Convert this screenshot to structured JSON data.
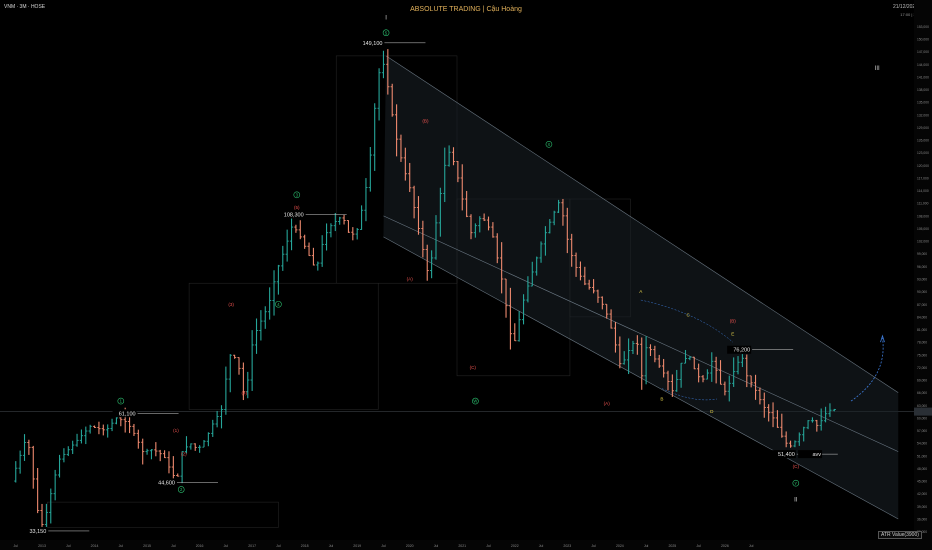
{
  "header": {
    "symbol": "VNM · 3M · HOSE",
    "brand": "ABSOLUTE TRADING | Cậu Hoàng",
    "date": "21/12/2025",
    "meta": "17:00 | 30"
  },
  "footer": {
    "atr_label": "ATR Value(3900)"
  },
  "colors": {
    "up": "#26a69a",
    "down": "#ef8a6f",
    "channel": "#8a9aa8",
    "background": "#000000",
    "label_green": "#2bbd6e",
    "label_red": "#ef5350",
    "label_yellow": "#e8d44d"
  },
  "chart_data": {
    "type": "candlestick",
    "price_axis": {
      "min": 31000,
      "max": 155000,
      "ticks": [
        33000,
        36000,
        39000,
        42000,
        45000,
        48000,
        51000,
        54000,
        57000,
        60000,
        63000,
        66000,
        69000,
        72000,
        75000,
        78000,
        81000,
        84000,
        87000,
        90000,
        93000,
        96000,
        99000,
        102000,
        105000,
        108000,
        111000,
        114000,
        117000,
        120000,
        123000,
        126000,
        129000,
        132000,
        135000,
        138000,
        141000,
        144000,
        147000,
        150000,
        153000
      ]
    },
    "time_axis": {
      "start": "2012-01",
      "end": "2026-12",
      "labels": [
        {
          "t": 2012.0,
          "text": "Jul"
        },
        {
          "t": 2012.5,
          "text": "2013"
        },
        {
          "t": 2013.0,
          "text": "Jul"
        },
        {
          "t": 2013.5,
          "text": "2014"
        },
        {
          "t": 2014.0,
          "text": "Jul"
        },
        {
          "t": 2014.5,
          "text": "2015"
        },
        {
          "t": 2015.0,
          "text": "Jul"
        },
        {
          "t": 2015.5,
          "text": "2016"
        },
        {
          "t": 2016.0,
          "text": "Jul"
        },
        {
          "t": 2016.5,
          "text": "2017"
        },
        {
          "t": 2017.0,
          "text": "Jul"
        },
        {
          "t": 2017.5,
          "text": "2018"
        },
        {
          "t": 2018.0,
          "text": "Jul"
        },
        {
          "t": 2018.5,
          "text": "2019"
        },
        {
          "t": 2019.0,
          "text": "Jul"
        },
        {
          "t": 2019.5,
          "text": "2020"
        },
        {
          "t": 2020.0,
          "text": "Jul"
        },
        {
          "t": 2020.5,
          "text": "2021"
        },
        {
          "t": 2021.0,
          "text": "Jul"
        },
        {
          "t": 2021.5,
          "text": "2022"
        },
        {
          "t": 2022.0,
          "text": "Jul"
        },
        {
          "t": 2022.5,
          "text": "2023"
        },
        {
          "t": 2023.0,
          "text": "Jul"
        },
        {
          "t": 2023.5,
          "text": "2024"
        },
        {
          "t": 2024.0,
          "text": "Jul"
        },
        {
          "t": 2024.5,
          "text": "2025"
        },
        {
          "t": 2025.0,
          "text": "Jul"
        },
        {
          "t": 2025.5,
          "text": "2026"
        },
        {
          "t": 2026.0,
          "text": "Jul"
        }
      ]
    },
    "path": [
      [
        2012.0,
        45000
      ],
      [
        2012.3,
        56000
      ],
      [
        2012.5,
        38000
      ],
      [
        2012.6,
        34000
      ],
      [
        2012.9,
        50000
      ],
      [
        2013.2,
        54000
      ],
      [
        2013.5,
        58000
      ],
      [
        2013.8,
        57000
      ],
      [
        2014.0,
        60000
      ],
      [
        2014.2,
        59000
      ],
      [
        2014.35,
        56000
      ],
      [
        2014.5,
        52000
      ],
      [
        2014.7,
        52500
      ],
      [
        2014.9,
        51000
      ],
      [
        2015.05,
        47000
      ],
      [
        2015.15,
        45000
      ],
      [
        2015.25,
        52000
      ],
      [
        2015.4,
        54000
      ],
      [
        2015.55,
        52500
      ],
      [
        2015.7,
        55000
      ],
      [
        2015.85,
        59000
      ],
      [
        2016.0,
        62000
      ],
      [
        2016.15,
        75000
      ],
      [
        2016.3,
        74000
      ],
      [
        2016.45,
        64000
      ],
      [
        2016.6,
        79000
      ],
      [
        2016.75,
        83000
      ],
      [
        2016.9,
        87000
      ],
      [
        2017.05,
        95000
      ],
      [
        2017.2,
        100000
      ],
      [
        2017.35,
        106000
      ],
      [
        2017.5,
        103000
      ],
      [
        2017.65,
        99000
      ],
      [
        2017.8,
        95000
      ],
      [
        2017.95,
        103000
      ],
      [
        2018.1,
        106000
      ],
      [
        2018.3,
        108000
      ],
      [
        2018.45,
        103000
      ],
      [
        2018.6,
        105000
      ],
      [
        2018.8,
        118000
      ],
      [
        2018.95,
        138000
      ],
      [
        2019.05,
        146000
      ],
      [
        2019.15,
        140000
      ],
      [
        2019.3,
        128000
      ],
      [
        2019.45,
        120000
      ],
      [
        2019.6,
        114000
      ],
      [
        2019.8,
        102000
      ],
      [
        2019.95,
        93000
      ],
      [
        2020.1,
        108000
      ],
      [
        2020.3,
        124000
      ],
      [
        2020.45,
        120000
      ],
      [
        2020.6,
        111000
      ],
      [
        2020.75,
        104000
      ],
      [
        2020.95,
        108000
      ],
      [
        2021.15,
        104000
      ],
      [
        2021.35,
        92000
      ],
      [
        2021.5,
        80000
      ],
      [
        2021.6,
        78000
      ],
      [
        2021.7,
        86000
      ],
      [
        2021.9,
        94000
      ],
      [
        2022.1,
        102000
      ],
      [
        2022.3,
        108000
      ],
      [
        2022.45,
        112000
      ],
      [
        2022.55,
        104000
      ],
      [
        2022.7,
        97000
      ],
      [
        2022.9,
        92000
      ],
      [
        2023.1,
        90000
      ],
      [
        2023.3,
        86000
      ],
      [
        2023.45,
        80000
      ],
      [
        2023.6,
        72000
      ],
      [
        2023.75,
        76000
      ],
      [
        2023.9,
        79000
      ],
      [
        2024.0,
        70000
      ],
      [
        2024.1,
        78000
      ],
      [
        2024.25,
        74000
      ],
      [
        2024.45,
        70000
      ],
      [
        2024.6,
        66000
      ],
      [
        2024.75,
        73000
      ],
      [
        2024.9,
        75000
      ],
      [
        2025.05,
        70000
      ],
      [
        2025.2,
        69000
      ],
      [
        2025.35,
        74000
      ],
      [
        2025.5,
        68000
      ],
      [
        2025.6,
        66000
      ],
      [
        2025.75,
        71000
      ],
      [
        2025.9,
        75000
      ],
      [
        2026.0,
        70000
      ],
      [
        2026.15,
        67000
      ],
      [
        2026.3,
        63000
      ],
      [
        2026.5,
        60000
      ],
      [
        2026.65,
        56000
      ],
      [
        2026.8,
        53000
      ],
      [
        2026.9,
        54000
      ],
      [
        2027.05,
        57000
      ],
      [
        2027.2,
        60000
      ],
      [
        2027.35,
        58000
      ],
      [
        2027.5,
        61000
      ],
      [
        2027.6,
        62000
      ]
    ],
    "price_labels": [
      {
        "text": "149,100",
        "t": 2019.0,
        "price": 149100
      },
      {
        "text": "108,300",
        "t": 2017.5,
        "price": 108300
      },
      {
        "text": "61,100",
        "t": 2014.3,
        "price": 61100
      },
      {
        "text": "44,600",
        "t": 2015.05,
        "price": 44600
      },
      {
        "text": "33,150",
        "t": 2012.6,
        "price": 33150
      },
      {
        "text": "76,200",
        "t": 2026.0,
        "price": 76200
      },
      {
        "text": "51,400",
        "t": 2026.85,
        "price": 51400
      },
      {
        "text": "avv",
        "t": 2027.35,
        "price": 51400
      }
    ],
    "wave_labels": [
      {
        "text": "I",
        "t": 2019.05,
        "price": 155000,
        "style": "plain"
      },
      {
        "text": "5",
        "t": 2019.05,
        "price": 151500,
        "style": "green-circle"
      },
      {
        "text": "3",
        "t": 2017.35,
        "price": 113000,
        "style": "green-circle"
      },
      {
        "text": "(5)",
        "t": 2017.35,
        "price": 110000,
        "style": "red"
      },
      {
        "text": "4",
        "t": 2017.0,
        "price": 87000,
        "style": "green-circle"
      },
      {
        "text": "(3)",
        "t": 2016.1,
        "price": 87000,
        "style": "red"
      },
      {
        "text": "(4)",
        "t": 2016.35,
        "price": 66000,
        "style": "red"
      },
      {
        "text": "1",
        "t": 2014.0,
        "price": 64000,
        "style": "green-circle"
      },
      {
        "text": "(1)",
        "t": 2015.05,
        "price": 57000,
        "style": "red"
      },
      {
        "text": "(2)",
        "t": 2015.2,
        "price": 51500,
        "style": "red"
      },
      {
        "text": "2",
        "t": 2015.15,
        "price": 43000,
        "style": "green-circle"
      },
      {
        "text": "(B)",
        "t": 2019.8,
        "price": 130500,
        "style": "red"
      },
      {
        "text": "(A)",
        "t": 2019.5,
        "price": 93000,
        "style": "red"
      },
      {
        "text": "(C)",
        "t": 2020.7,
        "price": 72000,
        "style": "red"
      },
      {
        "text": "W",
        "t": 2020.75,
        "price": 64000,
        "style": "green-circle"
      },
      {
        "text": "X",
        "t": 2022.15,
        "price": 125000,
        "style": "green-circle"
      },
      {
        "text": "(A)",
        "t": 2023.25,
        "price": 63500,
        "style": "red"
      },
      {
        "text": "A",
        "t": 2023.9,
        "price": 90000,
        "style": "yellow"
      },
      {
        "text": "B",
        "t": 2024.3,
        "price": 64500,
        "style": "yellow"
      },
      {
        "text": "C",
        "t": 2024.8,
        "price": 84500,
        "style": "yellow"
      },
      {
        "text": "D",
        "t": 2025.25,
        "price": 61500,
        "style": "yellow"
      },
      {
        "text": "E",
        "t": 2025.65,
        "price": 80000,
        "style": "yellow"
      },
      {
        "text": "(B)",
        "t": 2025.65,
        "price": 83000,
        "style": "red"
      },
      {
        "text": "(C)",
        "t": 2026.85,
        "price": 48500,
        "style": "red"
      },
      {
        "text": "Y",
        "t": 2026.85,
        "price": 44500,
        "style": "green-circle"
      },
      {
        "text": "II",
        "t": 2026.85,
        "price": 40500,
        "style": "plain"
      },
      {
        "text": "III",
        "t": 2028.4,
        "price": 143000,
        "style": "plain"
      }
    ],
    "channel": {
      "upper": [
        [
          2019.05,
          146000
        ],
        [
          2028.8,
          66000
        ]
      ],
      "middle": [
        [
          2019.0,
          108000
        ],
        [
          2028.8,
          52000
        ]
      ],
      "lower": [
        [
          2019.0,
          103000
        ],
        [
          2028.8,
          36000
        ]
      ]
    }
  }
}
